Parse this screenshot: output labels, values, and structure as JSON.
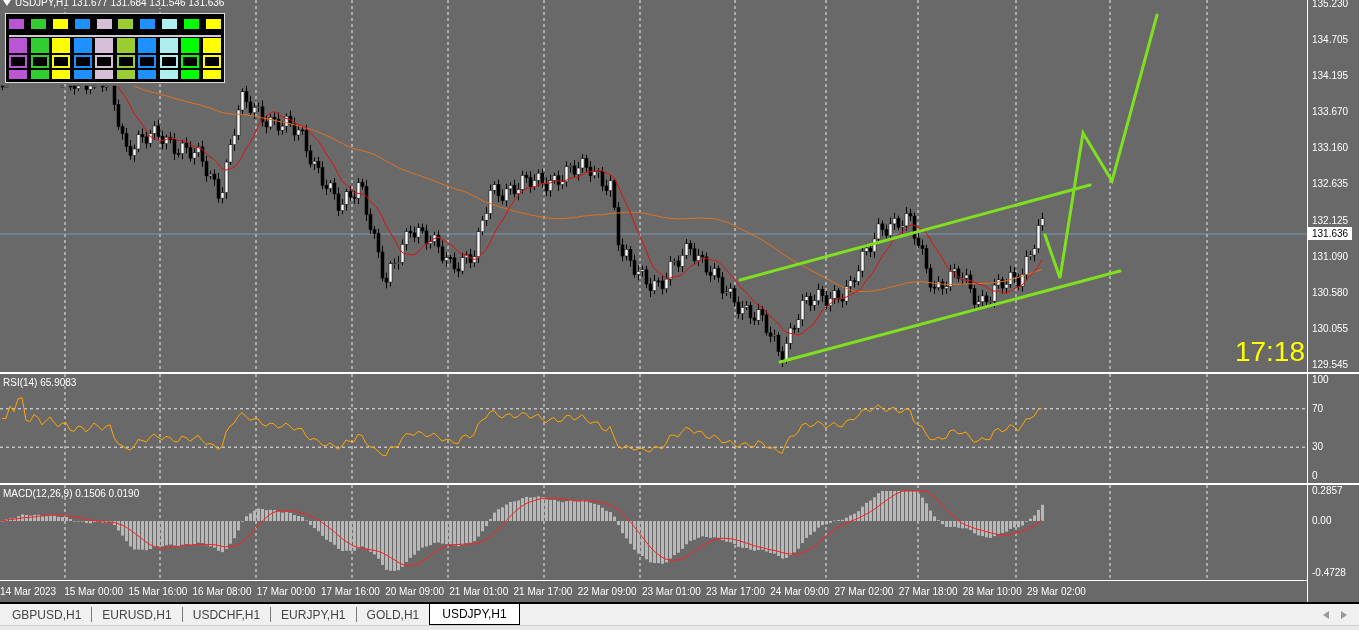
{
  "chart_header": {
    "text": "USDJPY,H1  131.677 131.684 131.546 131.636"
  },
  "palette": {
    "colors": [
      {
        "color": "#ba55d3"
      },
      {
        "color": "#32cd32"
      },
      {
        "color": "#ffff00"
      },
      {
        "color": "#1e90ff"
      },
      {
        "color": "#d8bfd8"
      },
      {
        "color": "#9acd32"
      },
      {
        "color": "#1e90ff"
      },
      {
        "color": "#afeeee"
      },
      {
        "color": "#00ff00"
      },
      {
        "color": "#ffff00"
      }
    ]
  },
  "price_axis": {
    "labels": [
      "135.230",
      "134.705",
      "134.195",
      "133.670",
      "133.160",
      "132.635",
      "132.125",
      "131.090",
      "130.580",
      "130.055",
      "129.545"
    ],
    "current_price": "131.636"
  },
  "clock": "17:18",
  "rsi": {
    "label": "RSI(14) 65.9083",
    "axis_labels": [
      "100",
      "70",
      "30",
      "0"
    ]
  },
  "macd": {
    "label": "MACD(12,26,9) 0.1506 0.0190",
    "axis_labels": [
      "0.2857",
      "0.00",
      "-0.4728"
    ]
  },
  "time_axis": {
    "labels": [
      "14 Mar 2023",
      "15 Mar 00:00",
      "15 Mar 16:00",
      "16 Mar 08:00",
      "17 Mar 00:00",
      "17 Mar 16:00",
      "20 Mar 09:00",
      "21 Mar 01:00",
      "21 Mar 17:00",
      "22 Mar 09:00",
      "23 Mar 01:00",
      "23 Mar 17:00",
      "24 Mar 09:00",
      "27 Mar 02:00",
      "27 Mar 18:00",
      "28 Mar 10:00",
      "29 Mar 02:00"
    ]
  },
  "tabs": [
    {
      "label": "GBPUSD,H1",
      "selected": false
    },
    {
      "label": "EURUSD,H1",
      "selected": false
    },
    {
      "label": "USDCHF,H1",
      "selected": false
    },
    {
      "label": "EURJPY,H1",
      "selected": false
    },
    {
      "label": "GOLD,H1",
      "selected": false
    },
    {
      "label": "USDJPY,H1",
      "selected": true
    }
  ]
}
